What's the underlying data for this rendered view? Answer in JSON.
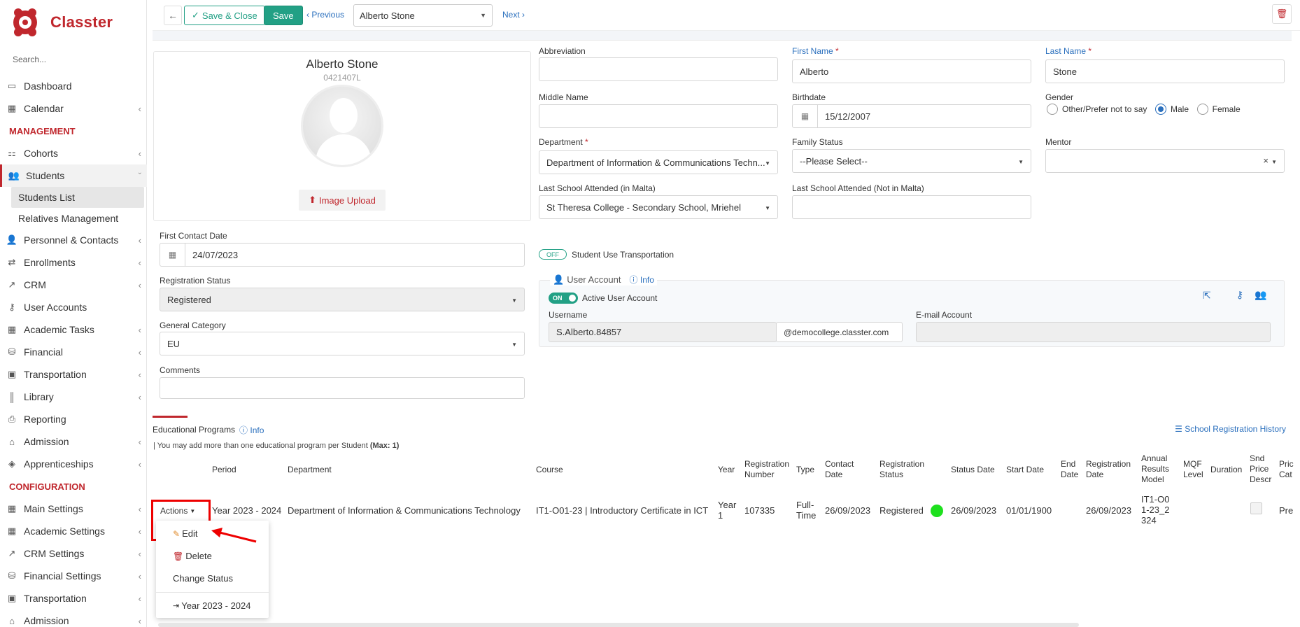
{
  "app": {
    "name": "Classter"
  },
  "sidebar": {
    "search_placeholder": "Search...",
    "items": [
      {
        "label": "Dashboard",
        "icon": "monitor-icon"
      },
      {
        "label": "Calendar",
        "icon": "calendar-icon"
      },
      {
        "section": "MANAGEMENT"
      },
      {
        "label": "Cohorts",
        "icon": "cohorts-icon"
      },
      {
        "label": "Students",
        "icon": "students-icon"
      },
      {
        "label": "Students List"
      },
      {
        "label": "Relatives Management"
      },
      {
        "label": "Personnel & Contacts",
        "icon": "personnel-icon"
      },
      {
        "label": "Enrollments",
        "icon": "enrollments-icon"
      },
      {
        "label": "CRM",
        "icon": "crm-icon"
      },
      {
        "label": "User Accounts",
        "icon": "key-icon"
      },
      {
        "label": "Academic Tasks",
        "icon": "grid-icon"
      },
      {
        "label": "Financial",
        "icon": "coins-icon"
      },
      {
        "label": "Transportation",
        "icon": "bus-icon"
      },
      {
        "label": "Library",
        "icon": "library-icon"
      },
      {
        "label": "Reporting",
        "icon": "printer-icon"
      },
      {
        "label": "Admission",
        "icon": "bank-icon"
      },
      {
        "label": "Apprenticeships",
        "icon": "cube-icon"
      },
      {
        "section": "CONFIGURATION"
      },
      {
        "label": "Main Settings",
        "icon": "grid-icon"
      },
      {
        "label": "Academic Settings",
        "icon": "grid-icon"
      },
      {
        "label": "CRM Settings",
        "icon": "crm-icon"
      },
      {
        "label": "Financial Settings",
        "icon": "coins-icon"
      },
      {
        "label": "Transportation",
        "icon": "bus-icon"
      },
      {
        "label": "Admission",
        "icon": "bank-icon"
      }
    ]
  },
  "toolbar": {
    "save_close": "Save & Close",
    "save": "Save",
    "previous": "Previous",
    "record_select": "Alberto Stone",
    "next": "Next"
  },
  "profile": {
    "name": "Alberto Stone",
    "id": "0421407L",
    "image_upload": "Image Upload"
  },
  "form": {
    "abbreviation": {
      "label": "Abbreviation",
      "value": ""
    },
    "first_name": {
      "label": "First Name",
      "value": "Alberto"
    },
    "last_name": {
      "label": "Last Name",
      "value": "Stone"
    },
    "middle_name": {
      "label": "Middle Name",
      "value": ""
    },
    "birthdate": {
      "label": "Birthdate",
      "value": "15/12/2007"
    },
    "gender": {
      "label": "Gender",
      "options": [
        "Other/Prefer not to say",
        "Male",
        "Female"
      ],
      "selected": "Male"
    },
    "department": {
      "label": "Department",
      "value": "Department of Information & Communications Techn..."
    },
    "family_status": {
      "label": "Family Status",
      "value": "--Please Select--"
    },
    "mentor": {
      "label": "Mentor",
      "value": "",
      "clear": "×"
    },
    "last_school_malta": {
      "label": "Last School Attended (in Malta)",
      "value": "St Theresa College - Secondary School, Mriehel"
    },
    "last_school_not_malta": {
      "label": "Last School Attended (Not in Malta)",
      "value": ""
    },
    "first_contact_date": {
      "label": "First Contact Date",
      "value": "24/07/2023"
    },
    "registration_status": {
      "label": "Registration Status",
      "value": "Registered"
    },
    "general_category": {
      "label": "General Category",
      "value": "EU"
    },
    "comments": {
      "label": "Comments",
      "value": ""
    },
    "transport": {
      "toggle": "OFF",
      "label": "Student Use Transportation"
    }
  },
  "user_account": {
    "legend": "User Account",
    "info": "Info",
    "toggle": "ON",
    "active_label": "Active User Account",
    "username_label": "Username",
    "username": "S.Alberto.84857",
    "domain": "@democollege.classter.com",
    "email_label": "E-mail Account",
    "email": ""
  },
  "programs": {
    "title": "Educational Programs",
    "info": "Info",
    "history": "School Registration History",
    "note": "| You may add more than one educational program per Student",
    "note_max": "(Max: 1)",
    "columns": [
      "Period",
      "Department",
      "Course",
      "Year",
      "Registration Number",
      "Type",
      "Contact Date",
      "Registration Status",
      "Status Date",
      "Start Date",
      "End Date",
      "Registration Date",
      "Annual Results Model",
      "MQF Level",
      "Duration",
      "Snd Price Descr",
      "Pric Cat"
    ],
    "row": {
      "actions": "Actions",
      "period": "Year 2023 - 2024",
      "department": "Department of Information & Communications Technology",
      "course": "IT1-O01-23 | Introductory Certificate in ICT",
      "year": "Year 1",
      "reg_number": "107335",
      "type": "Full-Time",
      "contact_date": "26/09/2023",
      "reg_status": "Registered",
      "status_date": "26/09/2023",
      "start_date": "01/01/1900",
      "end_date": "",
      "reg_date": "26/09/2023",
      "results_model": "IT1-O01-23_2324",
      "price_cat": "Pre"
    },
    "menu": [
      "Edit",
      "Delete",
      "Change Status",
      "Year 2023 - 2024"
    ]
  },
  "colors": {
    "brand": "#c0272d",
    "accent": "#22a085",
    "link": "#2a6fbd",
    "status_dot": "#1ee01e"
  }
}
